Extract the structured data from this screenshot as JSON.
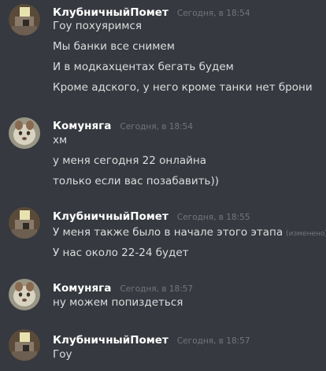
{
  "messages": [
    {
      "author": "КлубничныйПомет",
      "timestamp": "Сегодня, в 18:54",
      "lines": [
        "Гоу похуяримся",
        "Мы банки все снимем",
        "И в модкахцентах бегать будем",
        "Кроме адского, у него кроме танки нет брони"
      ]
    },
    {
      "author": "Комуняга",
      "timestamp": "Сегодня, в 18:54",
      "lines": [
        "хм",
        "у меня сегодня 22 онлайна",
        "только если вас позабавить))"
      ]
    },
    {
      "author": "КлубничныйПомет",
      "timestamp": "Сегодня, в 18:55",
      "lines": [
        "У меня также было в начале этого этапа",
        "У нас около 22-24 будет"
      ],
      "edited_label": "(изменено)"
    },
    {
      "author": "Комуняга",
      "timestamp": "Сегодня, в 18:57",
      "lines": [
        "ну можем попиздеться"
      ]
    },
    {
      "author": "КлубничныйПомет",
      "timestamp": "Сегодня, в 18:57",
      "lines": [
        "Гоу"
      ]
    }
  ],
  "colors": {
    "background": "#36393f",
    "username": "#ffffff",
    "text": "#dcddde",
    "muted": "#72767d"
  }
}
